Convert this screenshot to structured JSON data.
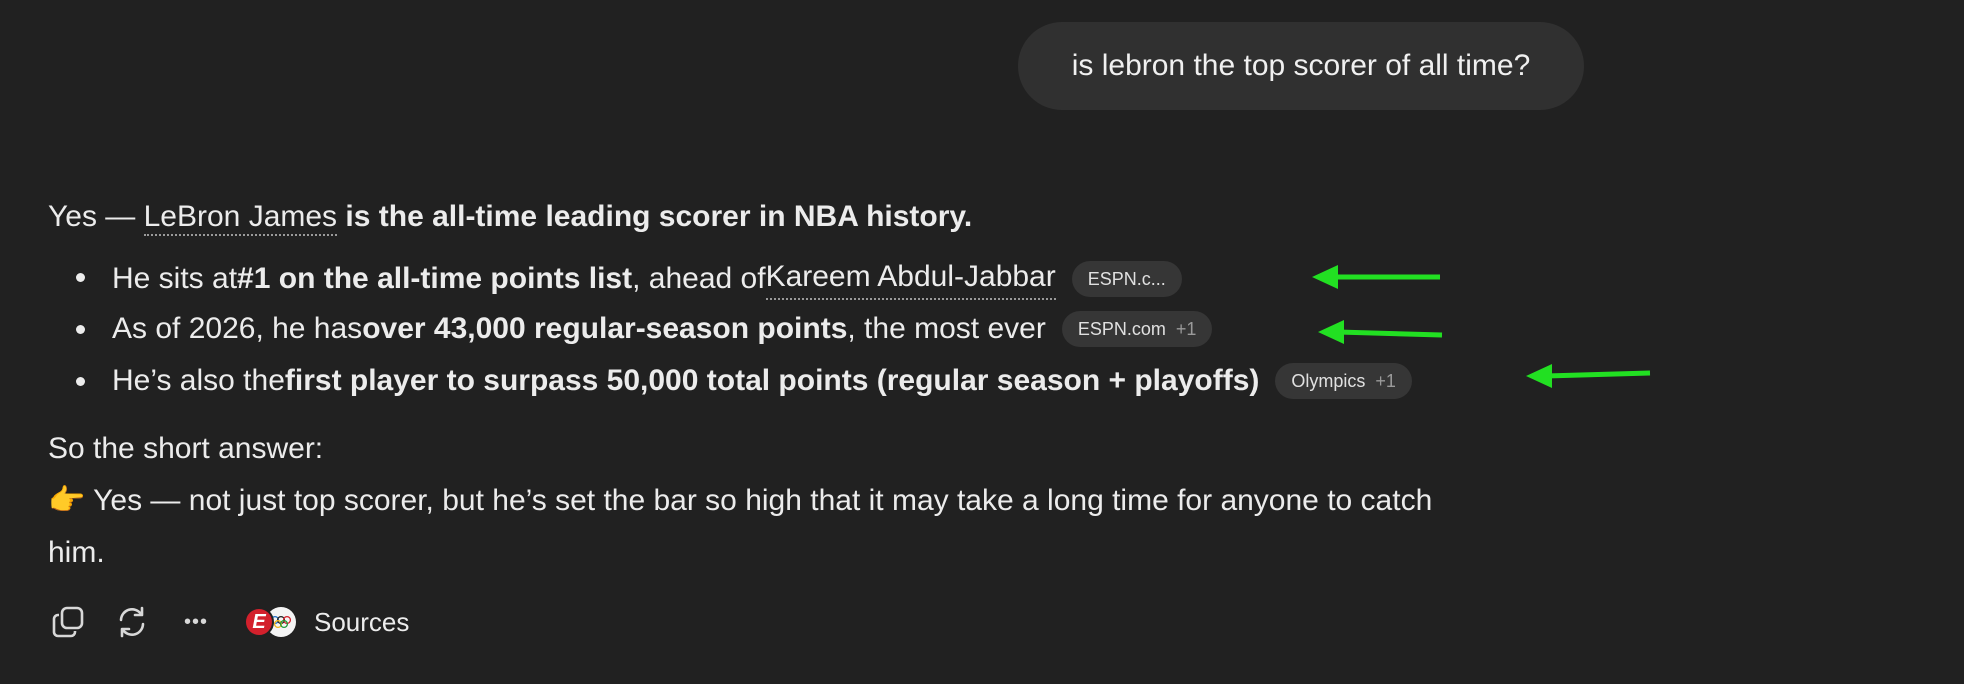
{
  "user_message": "is lebron the top scorer of all time?",
  "answer": {
    "intro": {
      "prefix": "Yes — ",
      "entity": "LeBron James",
      "bold": " is the all-time leading scorer in NBA history."
    },
    "bullets": [
      {
        "pre": "He sits at ",
        "bold": "#1 on the all-time points list",
        "mid": ", ahead of ",
        "entity": "Kareem Abdul-Jabbar",
        "chip_label": "ESPN.c...",
        "chip_extra": ""
      },
      {
        "pre": "As of 2026, he has ",
        "bold": "over 43,000 regular-season points",
        "post": ", the most ever",
        "chip_label": "ESPN.com",
        "chip_extra": "+1"
      },
      {
        "pre": "He’s also the ",
        "bold": "first player to surpass 50,000 total points (regular season + playoffs)",
        "chip_label": "Olympics",
        "chip_extra": "+1"
      }
    ],
    "short_answer_label": "So the short answer:",
    "conclusion_emoji": "👉",
    "conclusion_line1": " Yes — not just top scorer, but he’s set the bar so high that it may take a long time for anyone to catch",
    "conclusion_line2": "him."
  },
  "toolbar": {
    "icons": [
      "copy-icon",
      "regenerate-icon",
      "more-icon"
    ],
    "more_glyph": "•••",
    "source_logos": [
      "espn-logo",
      "olympics-logo"
    ],
    "espn_glyph": "E",
    "sources_label": "Sources"
  },
  "colors": {
    "background": "#212121",
    "bubble": "#303030",
    "chip": "#363636",
    "text": "#ececec",
    "annotation_arrow": "#22e022",
    "espn_red": "#d3202c"
  }
}
